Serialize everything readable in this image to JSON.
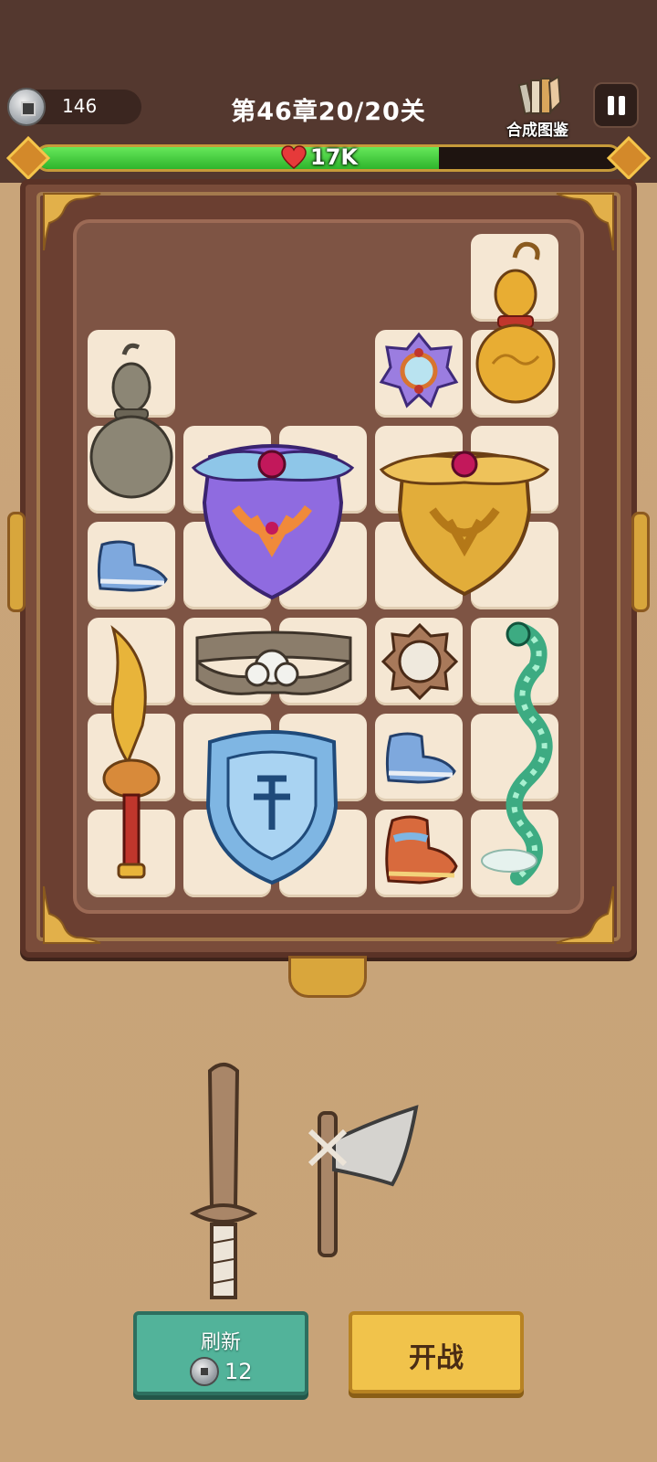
{
  "hud": {
    "coins": "146",
    "chapter": "第46章20/20关",
    "codex_label": "合成图鉴",
    "hp_text": "17K",
    "hp_fraction": 0.69
  },
  "board": {
    "items": [
      {
        "name": "golden-gourd",
        "color": "#e0a32c"
      },
      {
        "name": "grey-gourd",
        "color": "#8c8675"
      },
      {
        "name": "purple-talisman",
        "color": "#9b7de0"
      },
      {
        "name": "purple-armor",
        "color": "#8f6be0"
      },
      {
        "name": "golden-armor",
        "color": "#e2ad3a"
      },
      {
        "name": "blue-boots",
        "color": "#7ea8dd"
      },
      {
        "name": "golden-saber",
        "color": "#e8b43a"
      },
      {
        "name": "leather-belt",
        "color": "#8b7d6b"
      },
      {
        "name": "bronze-mirror",
        "color": "#a8795a"
      },
      {
        "name": "jade-dragon",
        "color": "#3dab82"
      },
      {
        "name": "ice-shield",
        "color": "#7fb6e3"
      },
      {
        "name": "blue-boots",
        "color": "#7ea8dd"
      },
      {
        "name": "red-boots",
        "color": "#d86a3d"
      }
    ]
  },
  "inventory": [
    {
      "name": "wooden-sword"
    },
    {
      "name": "stone-axe"
    }
  ],
  "buttons": {
    "refresh_label": "刷新",
    "refresh_cost": "12",
    "fight_label": "开战"
  },
  "colors": {
    "hp_green": "#3fd13a",
    "refresh_button": "#52b39a",
    "fight_button": "#f1c34b"
  }
}
